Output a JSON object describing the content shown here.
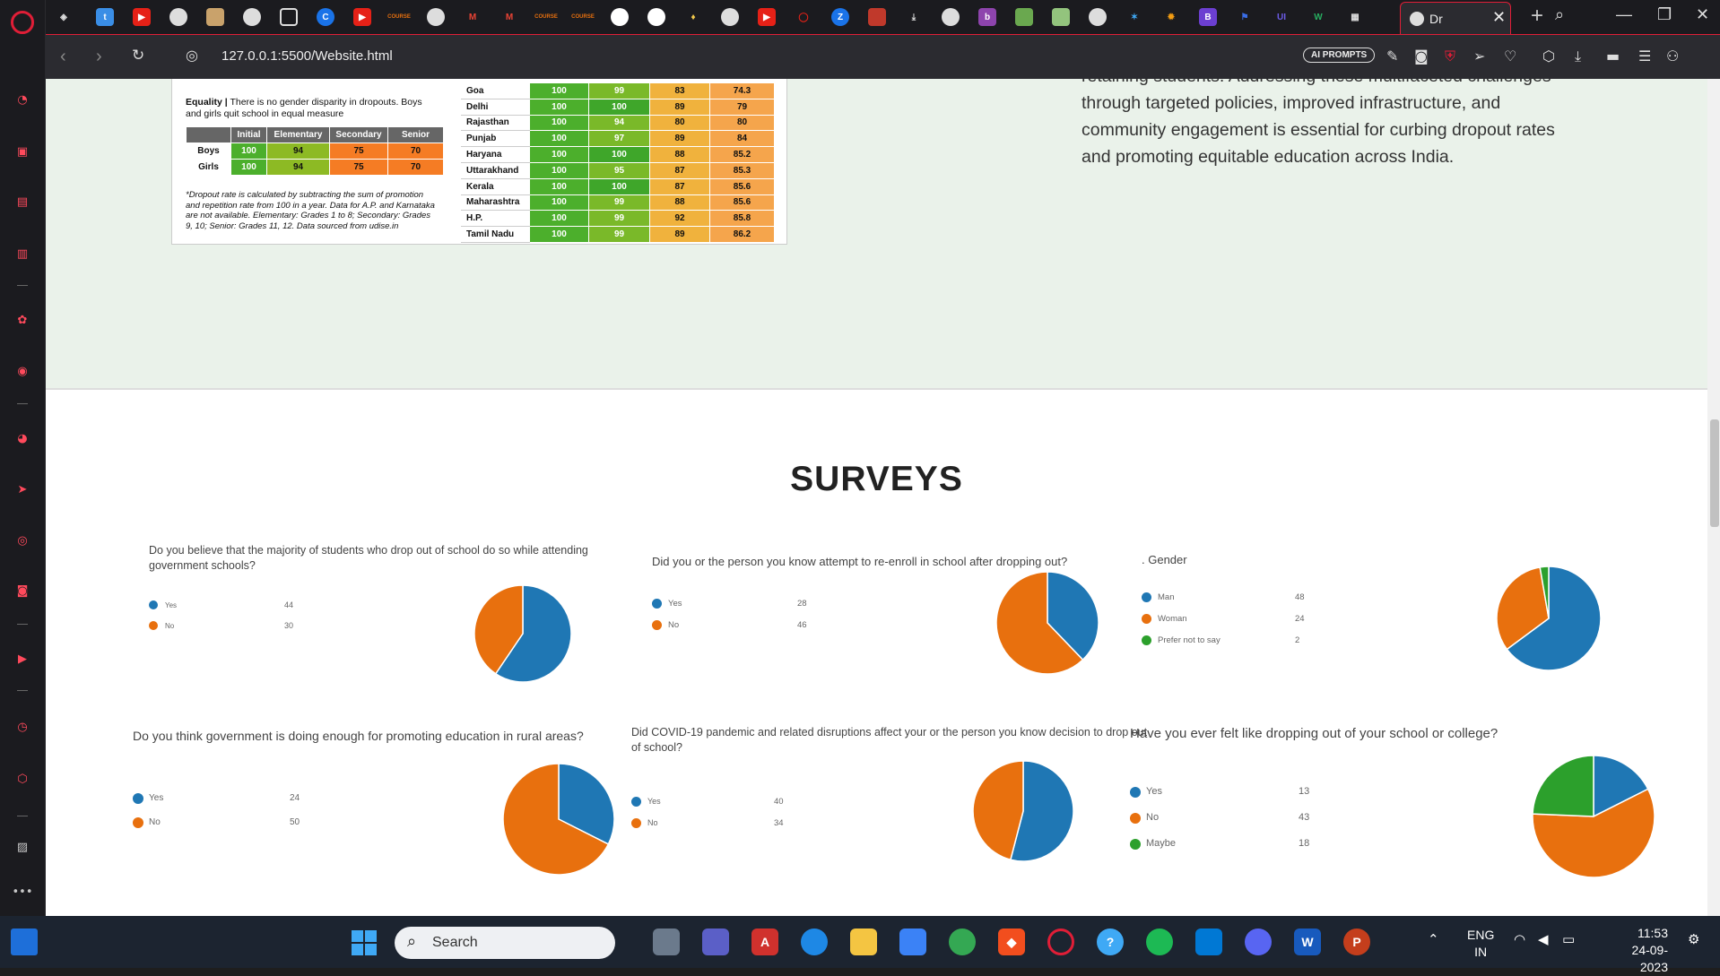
{
  "browser": {
    "url": "127.0.0.1:5500/Website.html",
    "active_tab_title": "Dr",
    "ai_prompts_label": "AI PROMPTS"
  },
  "infographic": {
    "equality_heading": "Equality |",
    "equality_text": "There is no gender disparity in dropouts. Boys and girls quit school in equal measure",
    "columns": [
      "Initial",
      "Elementary",
      "Secondary",
      "Senior"
    ],
    "rows": [
      {
        "label": "Boys",
        "values": [
          "100",
          "94",
          "75",
          "70"
        ]
      },
      {
        "label": "Girls",
        "values": [
          "100",
          "94",
          "75",
          "70"
        ]
      }
    ],
    "note": "*Dropout rate is calculated by subtracting the sum of promotion and repetition rate from 100 in a year. Data for A.P. and Karnataka are not available. Elementary: Grades 1 to 8; Secondary: Grades 9, 10; Senior: Grades 11, 12. Data sourced from udise.in",
    "states": [
      {
        "name": "Goa",
        "values": [
          "100",
          "99",
          "83",
          "74.3"
        ]
      },
      {
        "name": "Delhi",
        "values": [
          "100",
          "100",
          "89",
          "79"
        ]
      },
      {
        "name": "Rajasthan",
        "values": [
          "100",
          "94",
          "80",
          "80"
        ]
      },
      {
        "name": "Punjab",
        "values": [
          "100",
          "97",
          "89",
          "84"
        ]
      },
      {
        "name": "Haryana",
        "values": [
          "100",
          "100",
          "88",
          "85.2"
        ]
      },
      {
        "name": "Uttarakhand",
        "values": [
          "100",
          "95",
          "87",
          "85.3"
        ]
      },
      {
        "name": "Kerala",
        "values": [
          "100",
          "100",
          "87",
          "85.6"
        ]
      },
      {
        "name": "Maharashtra",
        "values": [
          "100",
          "99",
          "88",
          "85.6"
        ]
      },
      {
        "name": "H.P.",
        "values": [
          "100",
          "99",
          "92",
          "85.8"
        ]
      },
      {
        "name": "Tamil Nadu",
        "values": [
          "100",
          "99",
          "89",
          "86.2"
        ]
      }
    ]
  },
  "paragraph": "retaining students. Addressing these multifaceted challenges through targeted policies, improved infrastructure, and community engagement is essential for curbing dropout rates and promoting equitable education across India.",
  "surveys": {
    "title": "SURVEYS",
    "colors": {
      "blue": "#1f77b4",
      "orange": "#e8700e",
      "green": "#2ca02c"
    },
    "cards": [
      {
        "question": "Do you believe that the majority of students who drop out of school do so while attending government schools?",
        "items": [
          {
            "label": "Yes",
            "value": "44"
          },
          {
            "label": "No",
            "value": "30"
          }
        ]
      },
      {
        "question": "Did you or the person you know attempt to re-enroll in school after dropping out?",
        "items": [
          {
            "label": "Yes",
            "value": "28"
          },
          {
            "label": "No",
            "value": "46"
          }
        ]
      },
      {
        "question": ". Gender",
        "items": [
          {
            "label": "Man",
            "value": "48"
          },
          {
            "label": "Woman",
            "value": "24"
          },
          {
            "label": "Prefer not to say",
            "value": "2"
          }
        ]
      },
      {
        "question": "Do you think government is doing enough for promoting education in rural areas?",
        "items": [
          {
            "label": "Yes",
            "value": "24"
          },
          {
            "label": "No",
            "value": "50"
          }
        ]
      },
      {
        "question": " Did COVID-19 pandemic and related disruptions affect your or the person you know decision to drop out of school?",
        "items": [
          {
            "label": "Yes",
            "value": "40"
          },
          {
            "label": "No",
            "value": "34"
          }
        ]
      },
      {
        "question": "Have you ever felt like dropping out of your school or college?",
        "items": [
          {
            "label": "Yes",
            "value": "13"
          },
          {
            "label": "No",
            "value": "43"
          },
          {
            "label": "Maybe",
            "value": "18"
          }
        ]
      }
    ]
  },
  "chart_data": [
    {
      "type": "pie",
      "title": "Do you believe that the majority of students who drop out of school do so while attending government schools?",
      "categories": [
        "Yes",
        "No"
      ],
      "values": [
        44,
        30
      ]
    },
    {
      "type": "pie",
      "title": "Did you or the person you know attempt to re-enroll in school after dropping out?",
      "categories": [
        "Yes",
        "No"
      ],
      "values": [
        28,
        46
      ]
    },
    {
      "type": "pie",
      "title": ". Gender",
      "categories": [
        "Man",
        "Woman",
        "Prefer not to say"
      ],
      "values": [
        48,
        24,
        2
      ]
    },
    {
      "type": "pie",
      "title": "Do you think government is doing enough for promoting education in rural areas?",
      "categories": [
        "Yes",
        "No"
      ],
      "values": [
        24,
        50
      ]
    },
    {
      "type": "pie",
      "title": " Did COVID-19 pandemic and related disruptions affect your or the person you know decision to drop out of school?",
      "categories": [
        "Yes",
        "No"
      ],
      "values": [
        40,
        34
      ]
    },
    {
      "type": "pie",
      "title": "Have you ever felt like dropping out of your school or college?",
      "categories": [
        "Yes",
        "No",
        "Maybe"
      ],
      "values": [
        13,
        43,
        18
      ]
    }
  ],
  "taskbar": {
    "search_label": "Search",
    "lang_line1": "ENG",
    "lang_line2": "IN",
    "time": "11:53",
    "date": "24-09-2023"
  }
}
